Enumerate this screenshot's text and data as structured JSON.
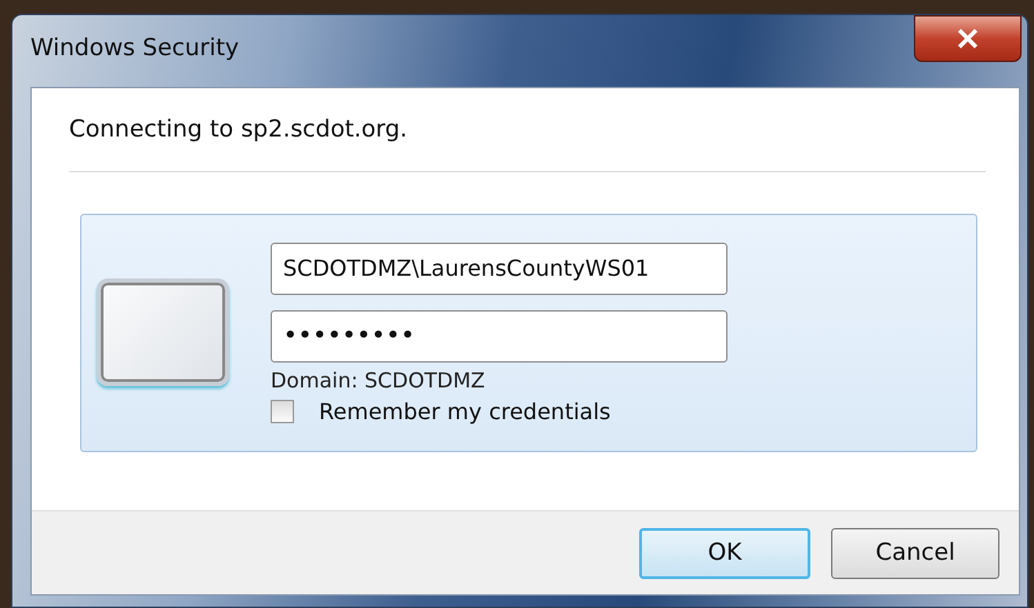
{
  "window": {
    "title": "Windows Security"
  },
  "message": "Connecting to sp2.scdot.org.",
  "credentials": {
    "username": "SCDOTDMZ\\LaurensCountyWS01",
    "password": "•••••••••",
    "domain": "Domain: SCDOTDMZ",
    "remember": {
      "label": "Remember my credentials",
      "checked": false
    }
  },
  "buttons": [
    {
      "label": "OK",
      "default": true
    },
    {
      "label": "Cancel",
      "default": false
    }
  ]
}
